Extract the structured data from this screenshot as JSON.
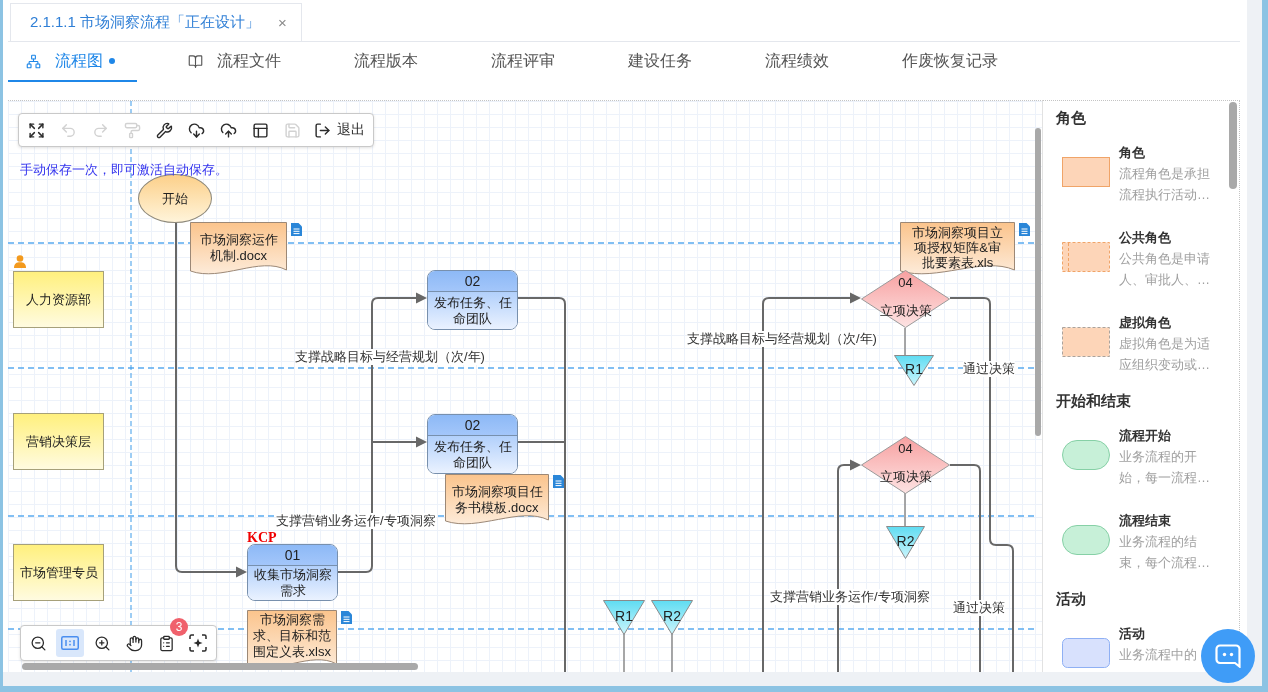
{
  "document_tab": {
    "title": "2.1.1.1 市场洞察流程「正在设计」",
    "close": "×"
  },
  "tabs": [
    {
      "label": "流程图",
      "kind": "diagram",
      "selected": true,
      "dot": true
    },
    {
      "label": "流程文件",
      "kind": "book",
      "selected": false,
      "dot": false
    },
    {
      "label": "流程版本",
      "kind": "plain",
      "selected": false,
      "dot": false
    },
    {
      "label": "流程评审",
      "kind": "plain",
      "selected": false,
      "dot": false
    },
    {
      "label": "建设任务",
      "kind": "plain",
      "selected": false,
      "dot": false
    },
    {
      "label": "流程绩效",
      "kind": "plain",
      "selected": false,
      "dot": false
    },
    {
      "label": "作废恢复记录",
      "kind": "plain",
      "selected": false,
      "dot": false
    }
  ],
  "toolbar": {
    "buttons": [
      {
        "kind": "fullscreen",
        "disabled": false
      },
      {
        "kind": "undo",
        "disabled": true
      },
      {
        "kind": "redo",
        "disabled": true
      },
      {
        "kind": "format_painter",
        "disabled": true
      },
      {
        "kind": "tools",
        "disabled": false
      },
      {
        "kind": "download",
        "disabled": false
      },
      {
        "kind": "upload",
        "disabled": false
      },
      {
        "kind": "layout",
        "disabled": false
      },
      {
        "kind": "save",
        "disabled": true
      },
      {
        "kind": "exit",
        "disabled": false,
        "label": "退出"
      }
    ]
  },
  "hint": "手动保存一次，即可激活自动保存。",
  "lanes": [
    {
      "name": "人力资源部",
      "owner": true
    },
    {
      "name": "营销决策层",
      "owner": false
    },
    {
      "name": "市场管理专员",
      "owner": false
    }
  ],
  "nodes": [
    {
      "kind": "start",
      "label": "开始"
    },
    {
      "kind": "document",
      "label": "市场洞察运作机制.docx"
    },
    {
      "kind": "activity",
      "number": "02",
      "label": "发布任务、任命团队"
    },
    {
      "kind": "activity",
      "number": "02",
      "label": "发布任务、任命团队"
    },
    {
      "kind": "document",
      "label": "市场洞察项目任务书模板.docx"
    },
    {
      "kind": "activity",
      "number": "01",
      "label": "收集市场洞察需求",
      "tag": "KCP"
    },
    {
      "kind": "document",
      "label": "市场洞察需求、目标和范围定义表.xlsx"
    },
    {
      "kind": "document",
      "label": "市场洞察项目立项授权矩阵&审批要素表.xls"
    },
    {
      "kind": "decision",
      "number": "04",
      "label": "立项决策"
    },
    {
      "kind": "reference",
      "label": "R1"
    },
    {
      "kind": "decision",
      "number": "04",
      "label": "立项决策"
    },
    {
      "kind": "reference",
      "label": "R2"
    },
    {
      "kind": "reference",
      "label": "R1"
    },
    {
      "kind": "reference",
      "label": "R2"
    }
  ],
  "edge_labels": [
    "支撑战略目标与经营规划（次/年)",
    "支撑战略目标与经营规划（次/年)",
    "通过决策",
    "支撑营销业务运作/专项洞察",
    "支撑营销业务运作/专项洞察",
    "通过决策"
  ],
  "zoom_toolbar": {
    "buttons": [
      {
        "kind": "zoom_out",
        "selected": false
      },
      {
        "kind": "actual_size",
        "selected": true
      },
      {
        "kind": "zoom_in",
        "selected": false
      },
      {
        "kind": "pan",
        "selected": false
      },
      {
        "kind": "clipboard",
        "selected": false,
        "badge": "3"
      },
      {
        "kind": "ai",
        "selected": false
      }
    ]
  },
  "legend": {
    "sections": [
      {
        "title": "角色",
        "items": [
          {
            "kind": "role",
            "title": "角色",
            "description": "流程角色是承担流程执行活动…"
          },
          {
            "kind": "public_role",
            "title": "公共角色",
            "description": "公共角色是申请人、审批人、…"
          },
          {
            "kind": "virtual_role",
            "title": "虚拟角色",
            "description": "虚拟角色是为适应组织变动或…"
          }
        ]
      },
      {
        "title": "开始和结束",
        "items": [
          {
            "kind": "start",
            "title": "流程开始",
            "description": "业务流程的开始，每一流程…"
          },
          {
            "kind": "end",
            "title": "流程结束",
            "description": "业务流程的结束，每个流程…"
          }
        ]
      },
      {
        "title": "活动",
        "items": [
          {
            "kind": "activity",
            "title": "活动",
            "description": "业务流程中的"
          }
        ]
      }
    ]
  }
}
